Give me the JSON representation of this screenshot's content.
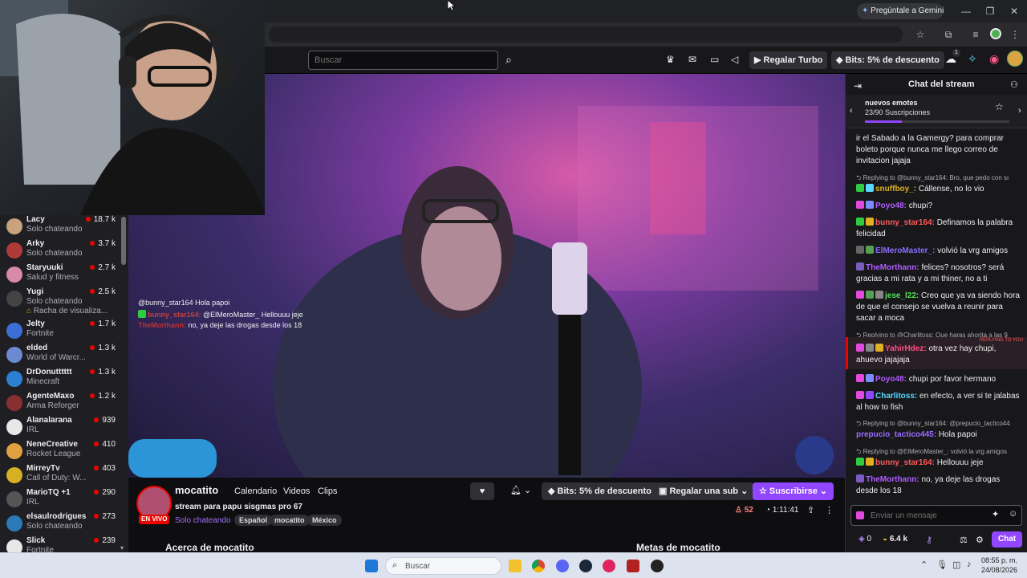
{
  "browser": {
    "gemini_label": "Pregúntale a Gemini",
    "window_controls": [
      "—",
      "❐",
      "✕"
    ]
  },
  "topnav": {
    "search_placeholder": "Buscar",
    "gift_turbo": "Regalar Turbo",
    "bits": "Bits: 5% de descuento",
    "notification_count": "1"
  },
  "sidebar": {
    "items": [
      {
        "name": "Lacy",
        "game": "Solo chateando",
        "viewers": "18.7 k",
        "color": "#c9a27e"
      },
      {
        "name": "Arky",
        "game": "Solo chateando",
        "viewers": "3.7 k",
        "color": "#b03a3a"
      },
      {
        "name": "Staryuuki",
        "game": "Salud y fitness",
        "viewers": "2.7 k",
        "color": "#d98aa8"
      },
      {
        "name": "Yugi",
        "game": "Solo chateando",
        "extra": "Racha de visualiza...",
        "viewers": "2.5 k",
        "color": "#444444"
      },
      {
        "name": "Jelty",
        "game": "Fortnite",
        "viewers": "1.7 k",
        "color": "#3b6fd6"
      },
      {
        "name": "elded",
        "game": "World of Warcr...",
        "viewers": "1.3 k",
        "color": "#6c8ad1"
      },
      {
        "name": "DrDonutttttt",
        "game": "Minecraft",
        "viewers": "1.3 k",
        "color": "#2d7fd1"
      },
      {
        "name": "AgenteMaxo",
        "game": "Arma Reforger",
        "viewers": "1.2 k",
        "color": "#8a2f2f"
      },
      {
        "name": "Alanalarana",
        "game": "IRL",
        "viewers": "939",
        "color": "#e8e8e8"
      },
      {
        "name": "NeneCreative",
        "game": "Rocket League",
        "viewers": "410",
        "color": "#e0a040"
      },
      {
        "name": "MirreyTv",
        "game": "Call of Duty: W...",
        "viewers": "403",
        "color": "#d4b022"
      },
      {
        "name": "MarioTQ +1",
        "game": "IRL",
        "viewers": "290",
        "color": "#555555"
      },
      {
        "name": "elsaulrodrigues",
        "game": "Solo chateando",
        "viewers": "273",
        "color": "#2a7ab8"
      },
      {
        "name": "Slick",
        "game": "Fortnite",
        "viewers": "239",
        "color": "#e8e8e8"
      }
    ]
  },
  "video_overlay": [
    {
      "user": "",
      "text": "@bunny_star164 Hola papoi",
      "color": "#9b6bff"
    },
    {
      "user": "bunny_star164:",
      "text": "@ElMeroMaster_ Hellouuu jeje",
      "color": "#c04040"
    },
    {
      "user": "TheMorthann:",
      "text": "no, ya deje las drogas desde los 18",
      "color": "#c03030"
    }
  ],
  "channel": {
    "name": "mocatito",
    "tabs": [
      "Calendario",
      "Videos",
      "Clips"
    ],
    "title": "stream para papu sisgmas pro 67",
    "live_badge": "EN VIVO",
    "category": "Solo chateando",
    "tags": [
      "Español",
      "mocatito",
      "México"
    ],
    "viewers": "52",
    "uptime": "1:11:41",
    "bits": "Bits: 5% de descuento",
    "gift_sub": "Regalar una sub",
    "subscribe": "Suscribirse",
    "about": "Acerca de mocatito",
    "goals": "Metas de mocatito"
  },
  "chat": {
    "header": "Chat del stream",
    "emotes_title": "nuevos emotes",
    "emotes_progress_text": "23/90 Suscripciones",
    "emotes_progress": 0.256,
    "messages": [
      {
        "reply": "",
        "user": "",
        "user_color": "#efeff1",
        "text": "ir el Sabado a la Gamergy? para comprar boleto porque nunca me llego correo de invitacion jajaja"
      },
      {
        "reply": "Replying to @bunny_star164: Bro, que pedo con sı",
        "user": "snuffboy_:",
        "user_color": "#e0b020",
        "text": "Cállense, no lo vio"
      },
      {
        "reply": "",
        "user": "Poyo48:",
        "user_color": "#b05cff",
        "text": "chupi?"
      },
      {
        "reply": "",
        "user": "bunny_star164:",
        "user_color": "#ff5a5a",
        "text": "Definamos la palabra felicidad"
      },
      {
        "reply": "",
        "user": "ElMeroMaster_:",
        "user_color": "#8a6cff",
        "text": "volvió la vrg amigos"
      },
      {
        "reply": "",
        "user": "TheMorthann:",
        "user_color": "#b05cff",
        "text": "felices? nosotros? será gracias a mi rata y a mi thiner, no a ti"
      },
      {
        "reply": "",
        "user": "jese_l22:",
        "user_color": "#54e254",
        "text": "Creo que ya va siendo hora de que el consejo se vuelva a reunir para sacar a moca"
      },
      {
        "reply": "Replying to @Charlitoss: Que haras ahorita a las 9",
        "user": "YahirHdez:",
        "user_color": "#ff4f8a",
        "text": "otra vez hay chupi, ahuevo jajajaja"
      },
      {
        "reply": "",
        "user": "Poyo48:",
        "user_color": "#b05cff",
        "text": "chupi por favor hermano"
      },
      {
        "reply": "",
        "user": "Charlitoss:",
        "user_color": "#5ad6ff",
        "text": "en efecto, a ver si te jalabas al how to fish"
      },
      {
        "reply": "Replying to @bunny_star164: @prepucio_tactico44",
        "user": "prepucio_tactico445:",
        "user_color": "#9b6bff",
        "text": "Hola papoi"
      },
      {
        "reply": "Replying to @ElMeroMaster_: volvió la vrg amigos",
        "user": "bunny_star164:",
        "user_color": "#ff5a5a",
        "text": "Hellouuu jeje"
      },
      {
        "reply": "",
        "user": "TheMorthann:",
        "user_color": "#b05cff",
        "text": "no, ya deje las drogas desde los 18"
      }
    ],
    "replying_to_you": "REPLYING TO YOU",
    "input_placeholder": "Enviar un mensaje",
    "points": "0",
    "bits_balance": "6.4 k",
    "chat_button": "Chat"
  },
  "taskbar": {
    "search_placeholder": "Buscar",
    "time": "08:55 p. m.",
    "date": "24/08/2026"
  }
}
